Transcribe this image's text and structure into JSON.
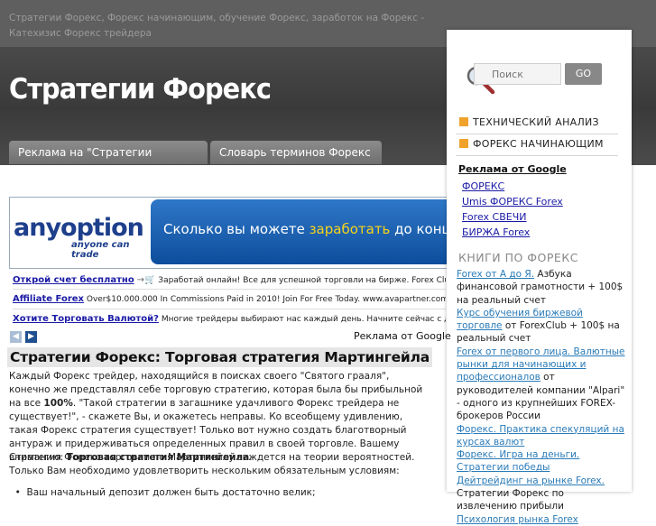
{
  "header": {
    "tagline": "Стратегии Форекс, Форекс начинающим, обучение Форекс, заработок на Форекс - Катехизис Форекс трейдера",
    "site_title": "Стратегии Форекс",
    "tabs": [
      "Реклама на \"Стратегии Форекс\"",
      "Словарь терминов Форекс"
    ]
  },
  "search": {
    "placeholder": "Поиск",
    "button": "GO"
  },
  "sidebar": {
    "categories": [
      "ТЕХНИЧЕСКИЙ АНАЛИЗ",
      "ФОРЕКС НАЧИНАЮЩИМ"
    ],
    "ads_title": "Реклама от Google",
    "ads_links": [
      "ФОРЕКС",
      "Umis ФОРЕКС Forex",
      "Forex СВЕЧИ",
      "БИРЖА Forex"
    ],
    "books_title": "КНИГИ ПО ФОРЕКС",
    "books": [
      {
        "link": "Forex от А до Я.",
        "text": " Азбука финансовой грамотности + 100$ на реальный счет"
      },
      {
        "link": "Курс обучения биржевой торговле",
        "text": " от ForexClub + 100$ на реальный счет"
      },
      {
        "link": "Forex от первого лица. Валютные рынки для начинающих и профессионалов",
        "text": " от руководителей компании \"Alpari\" - одного из крупнейших FOREX-брокеров России"
      },
      {
        "link": "Форекс. Практика спекуляций на курсах валют",
        "text": ""
      },
      {
        "link": "Форекс. Игра на деньги. Стратегии победы",
        "text": ""
      },
      {
        "link": "Дейтрейдинг на рынке Forex.",
        "text": ""
      },
      {
        "link": "",
        "text": "Стратегии Форекс по извлечению прибыли"
      },
      {
        "link": "Психология рынка Forex",
        "text": ""
      }
    ],
    "ads_overlay": "Реклама от Google"
  },
  "banner": {
    "logo": "anyoption",
    "sublogo": "anyone can trade",
    "text_a": "Сколько вы можете ",
    "text_b": "заработать",
    "text_c": " до конца"
  },
  "ads": [
    {
      "title": "Открой счет бесплатно",
      "icon": "cart-icon",
      "text": " Заработай онлайн! Все для успешной торговли на бирже. Forex Club www.fxclub.org"
    },
    {
      "title": "Affiliate Forex",
      "icon": "",
      "text": " Over$10.000.000 In Commissions Paid in 2010! Join For Free Today. www.avapartner.com"
    },
    {
      "title": "Хотите Торговать Валютой?",
      "icon": "",
      "text": " Многие трейдеры выбирают нас каждый день. Начните сейчас с демо счет..."
    }
  ],
  "ads_google_small": "Реклама от Google",
  "post": {
    "title": "Стратегии Форекс: Торговая стратегия Мартингейла",
    "p1_a": "Каждый Форекс трейдер, находящийся в поисках своего \"Святого грааля\", конечно же представлял себе торговую стратегию, которая была бы прибыльной на все ",
    "p1_b": "100%",
    "p1_c": ". \"Такой стратегии в загашнике удачливого Форекс трейдера не существует!\", - скажете Вы, и окажетесь неправы. Ко всеобщему удивлению, такая Форекс стратегия существует! Только вот нужно создать благотворный антураж и придерживаться определенных правил в своей торговле. Вашему вниманию: ",
    "p1_d": "Торговая стратегия Мартингейла",
    "p1_e": ".",
    "p2": "Стратегия Форекс торговли по Мартингейлу зиждется на теории вероятностей. Только Вам необходимо удовлетворить нескольким обязательным условиям:",
    "p3": "Ваш начальный депозит должен быть достаточно велик;"
  }
}
